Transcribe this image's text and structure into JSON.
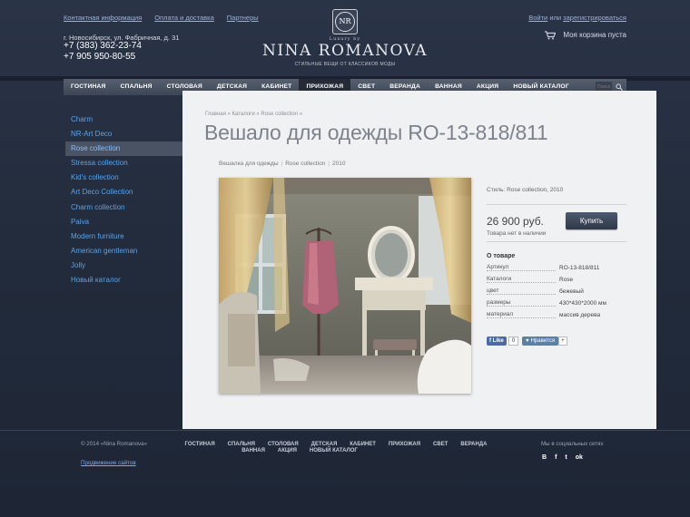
{
  "header": {
    "links": [
      "Контактная информация",
      "Оплата и доставка",
      "Партнеры"
    ],
    "address": "г. Новосибирск, ул. Фабричная, д. 31",
    "phones": [
      "+7 (383) 362-23-74",
      "+7 905 950-80-55"
    ],
    "logo": {
      "monogram": "NR",
      "small": "Luxury by",
      "name": "NINA ROMANOVA",
      "tagline": "СТИЛЬНЫЕ ВЕЩИ ОТ КЛАССИКОВ МОДЫ"
    },
    "auth": {
      "login": "Войти",
      "or": "или",
      "register": "зарегистрироваться"
    },
    "cart": "Моя корзина пуста"
  },
  "nav": {
    "items": [
      "ГОСТИНАЯ",
      "СПАЛЬНЯ",
      "СТОЛОВАЯ",
      "ДЕТСКАЯ",
      "КАБИНЕТ",
      "ПРИХОЖАЯ",
      "СВЕТ",
      "ВЕРАНДА",
      "ВАННАЯ",
      "АКЦИЯ",
      "НОВЫЙ КАТАЛОГ"
    ],
    "active": "ПРИХОЖАЯ",
    "search_placeholder": "Поиск"
  },
  "sidebar": {
    "items": [
      "Charm",
      "NR-Art Deco",
      "Rose collection",
      "Stressa collection",
      "Kid's collection",
      "Art Deco Collection",
      "Charm collection",
      "Paiva",
      "Modern furniture",
      "American gentleman",
      "Jolly",
      "Новый каталог"
    ],
    "active": "Rose collection"
  },
  "main": {
    "breadcrumb": [
      "Главная",
      "Каталоги",
      "Rose collection"
    ],
    "title": "Вешало для одежды RO-13-818/811",
    "tags": [
      "Вешалка для одежды",
      "Rose collection",
      "2010"
    ],
    "style_line": "Стиль: Rose collection, 2010",
    "price": "26 900 руб.",
    "buy_label": "Купить",
    "stock": "Товара нет в наличии",
    "about_title": "О товаре",
    "specs": [
      {
        "key": "Артикул",
        "value": "RO-13-818/811"
      },
      {
        "key": "Каталоги",
        "value": "Rose"
      },
      {
        "key": "цвет",
        "value": "бежевый"
      },
      {
        "key": "размеры",
        "value": "430*430*2000 мм"
      },
      {
        "key": "материал",
        "value": "массив дерева"
      }
    ],
    "fb": {
      "label": "Like",
      "count": "0"
    },
    "vk": {
      "label": "Нравится",
      "count": "+"
    }
  },
  "footer": {
    "copyright": "© 2014 «Nina Romanova»",
    "dev_link": "Продвижение сайтов",
    "nav_row1": [
      "ГОСТИНАЯ",
      "СПАЛЬНЯ",
      "СТОЛОВАЯ",
      "ДЕТСКАЯ",
      "КАБИНЕТ",
      "ПРИХОЖАЯ",
      "СВЕТ",
      "ВЕРАНДА"
    ],
    "nav_row2": [
      "ВАННАЯ",
      "АКЦИЯ",
      "НОВЫЙ КАТАЛОГ"
    ],
    "social_title": "Мы в социальных сетях",
    "social": [
      "B",
      "f",
      "t",
      "ok"
    ]
  },
  "colors": {
    "background": "#242d3e",
    "link_blue": "#5aa2e8",
    "panel": "#f0f1f3",
    "buy_button": "#3a4558"
  }
}
